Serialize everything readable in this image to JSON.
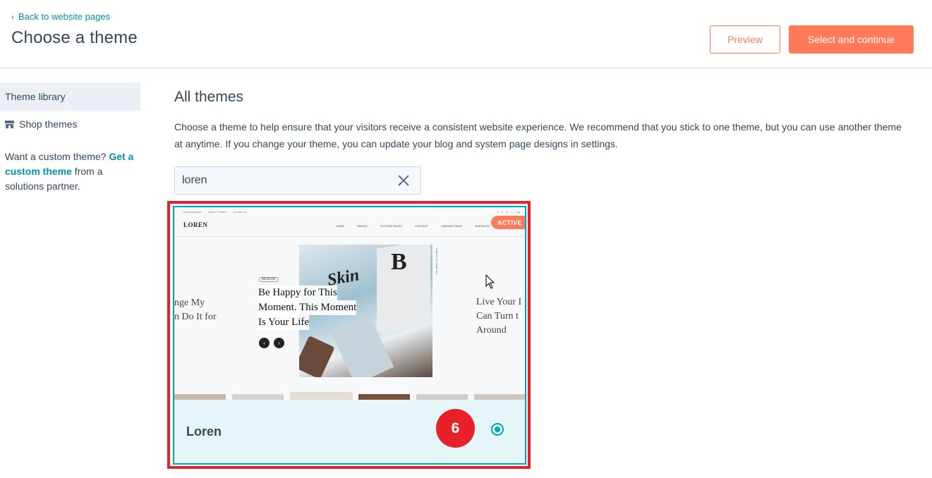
{
  "header": {
    "back_label": "Back to website pages",
    "title": "Choose a theme",
    "preview_label": "Preview",
    "select_label": "Select and continue"
  },
  "sidebar": {
    "items": [
      {
        "label": "Theme library",
        "active": true
      },
      {
        "label": "Shop themes",
        "icon": "store-icon"
      }
    ],
    "note": {
      "prefix": "Want a custom theme? ",
      "link": "Get a custom theme",
      "suffix": " from a solutions partner."
    }
  },
  "main": {
    "title": "All themes",
    "description": "Choose a theme to help ensure that your visitors receive a consistent website experience. We recommend that you stick to one theme, but you can use another theme at anytime. If you change your theme, you can update your blog and system page designs in settings.",
    "search": {
      "value": "loren"
    },
    "themes": [
      {
        "name": "Loren",
        "badge": "ACTIVE",
        "selected": true,
        "step_number": "6",
        "thumbnail": {
          "top_links": [
            "Documentation",
            "Home Themes",
            "Contact Us"
          ],
          "logo": "LOREN",
          "nav": [
            "HOME",
            "SINGLE",
            "SYSTEM PAGES",
            "CONTACT",
            "LANDING PAGE",
            "OUR BLOG"
          ],
          "tag": "HEALTH",
          "headline": [
            "Be Happy for This",
            "Moment. This Moment",
            "Is Your Life"
          ],
          "left_text": [
            "nge My",
            "n Do It for"
          ],
          "right_text": [
            "Live Your I",
            "Can Turn t",
            "Around"
          ],
          "side_caption": "August 19 | Mark Joe",
          "social": "f • y • ig",
          "hero_mark": "B",
          "hero_script": "Skin"
        }
      }
    ]
  },
  "colors": {
    "accent": "#ff7a59",
    "link": "#0091ae",
    "selected_border": "#00a4bd",
    "highlight": "#e8202a"
  }
}
